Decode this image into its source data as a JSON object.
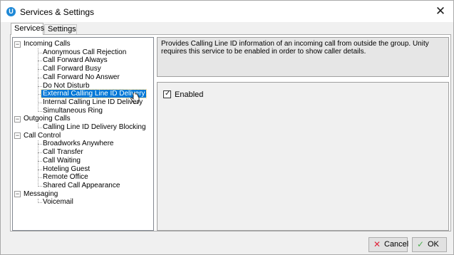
{
  "window": {
    "icon_letter": "U",
    "title": "Services & Settings",
    "close_glyph": "✕"
  },
  "tabs": [
    {
      "label": "Services",
      "active": true
    },
    {
      "label": "Settings",
      "active": false
    }
  ],
  "tree": {
    "groups": [
      {
        "label": "Incoming Calls",
        "expanded": true,
        "items": [
          "Anonymous Call Rejection",
          "Call Forward Always",
          "Call Forward Busy",
          "Call Forward No Answer",
          "Do Not Disturb",
          "External Calling Line ID Delivery",
          "Internal Calling Line ID Delivery",
          "Simultaneous Ring"
        ]
      },
      {
        "label": "Outgoing Calls",
        "expanded": true,
        "items": [
          "Calling Line ID Delivery Blocking"
        ]
      },
      {
        "label": "Call Control",
        "expanded": true,
        "items": [
          "Broadworks Anywhere",
          "Call Transfer",
          "Call Waiting",
          "Hoteling Guest",
          "Remote Office",
          "Shared Call Appearance"
        ]
      },
      {
        "label": "Messaging",
        "expanded": true,
        "items": [
          "Voicemail"
        ]
      }
    ],
    "selected": "External Calling Line ID Delivery",
    "expander_glyph": "−"
  },
  "description": "Provides Calling Line ID information of an incoming call from outside the group.  Unity requires this service to be enabled in order to show caller details.",
  "settings": {
    "enabled_label": "Enabled",
    "enabled_checked": true,
    "check_glyph": "✓"
  },
  "buttons": {
    "cancel_label": "Cancel",
    "cancel_icon": "✕",
    "ok_label": "OK",
    "ok_icon": "✓"
  },
  "colors": {
    "selection": "#0078d7",
    "brand": "#1e88d6",
    "cancel_icon": "#e0243b",
    "ok_icon": "#4caf50"
  }
}
